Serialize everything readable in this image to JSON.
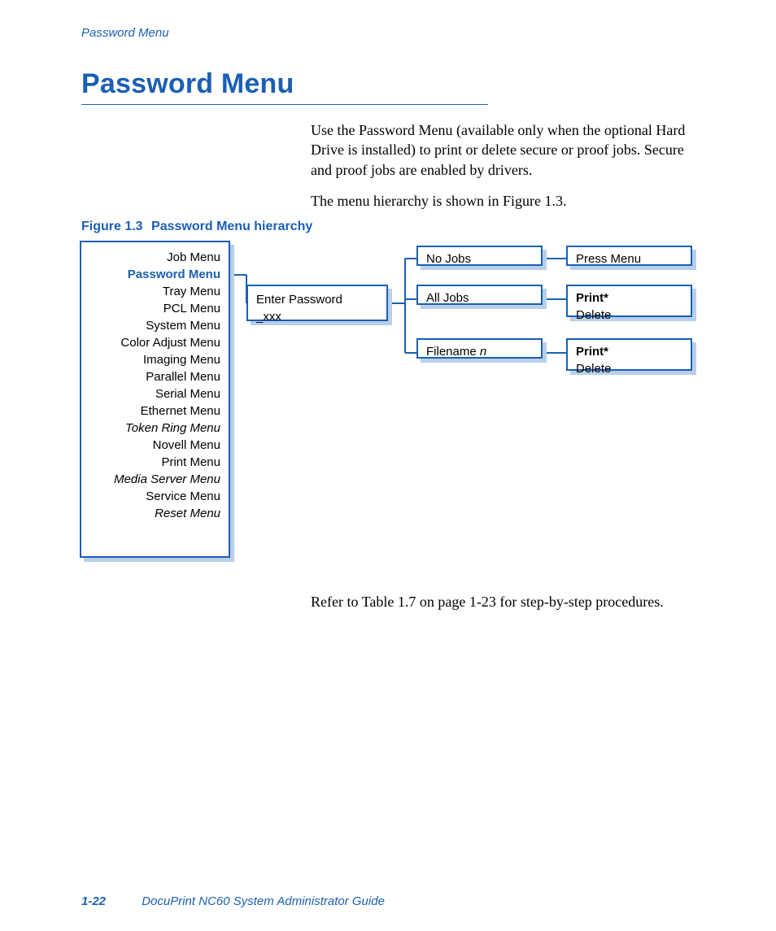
{
  "running_head": "Password Menu",
  "title": "Password Menu",
  "intro_p1": "Use the Password Menu (available only when the optional Hard Drive is installed) to print or delete secure or proof jobs. Secure and proof jobs are enabled by drivers.",
  "intro_p2": "The menu hierarchy is shown in Figure 1.3.",
  "fig_label": "Figure 1.3",
  "fig_title": "Password Menu hierarchy",
  "menu_items": {
    "i0": "Job Menu",
    "i1": "Password Menu",
    "i2": "Tray Menu",
    "i3": "PCL Menu",
    "i4": "System Menu",
    "i5": "Color Adjust Menu",
    "i6": "Imaging Menu",
    "i7": "Parallel Menu",
    "i8": "Serial Menu",
    "i9": "Ethernet Menu",
    "i10": "Token Ring Menu",
    "i11": "Novell Menu",
    "i12": "Print Menu",
    "i13": "Media Server Menu",
    "i14": "Service Menu",
    "i15": "Reset Menu"
  },
  "enter_pw_l1": "Enter Password",
  "enter_pw_l2": "_xxx",
  "no_jobs": "No Jobs",
  "all_jobs": "All Jobs",
  "filename_prefix": "Filename ",
  "filename_n": "n",
  "press_menu": "Press Menu",
  "print_star": "Print*",
  "delete": "Delete",
  "after_text": "Refer to Table 1.7 on page 1-23 for step-by-step procedures.",
  "footer_page": "1-22",
  "footer_book": "DocuPrint NC60 System Administrator Guide"
}
